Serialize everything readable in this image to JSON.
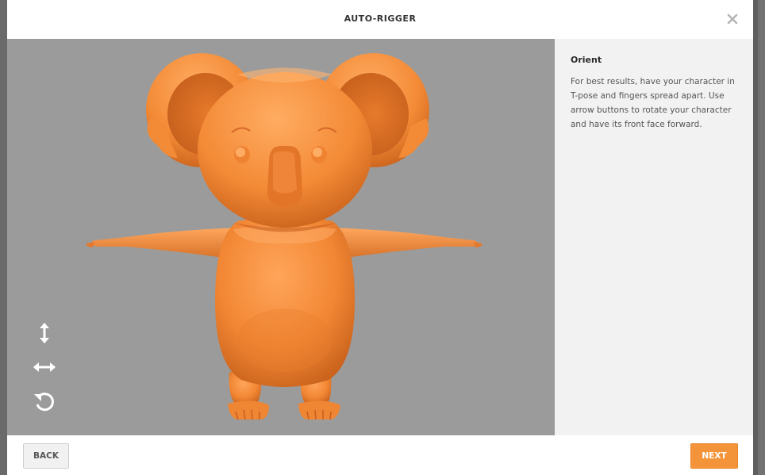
{
  "modal": {
    "title": "AUTO-RIGGER",
    "close_icon": "close-icon"
  },
  "viewport": {
    "model_description": "orange koala character in T-pose",
    "model_color": "#f08a3a",
    "background_color": "#9b9b9b",
    "tools": [
      {
        "name": "vertical-arrows-icon"
      },
      {
        "name": "horizontal-arrows-icon"
      },
      {
        "name": "rotate-icon"
      }
    ]
  },
  "side_panel": {
    "title": "Orient",
    "text": "For best results, have your character in T-pose and fingers spread apart. Use arrow buttons to rotate your character and have its front face forward."
  },
  "footer": {
    "back_label": "BACK",
    "next_label": "NEXT",
    "accent_color": "#f4943a"
  }
}
